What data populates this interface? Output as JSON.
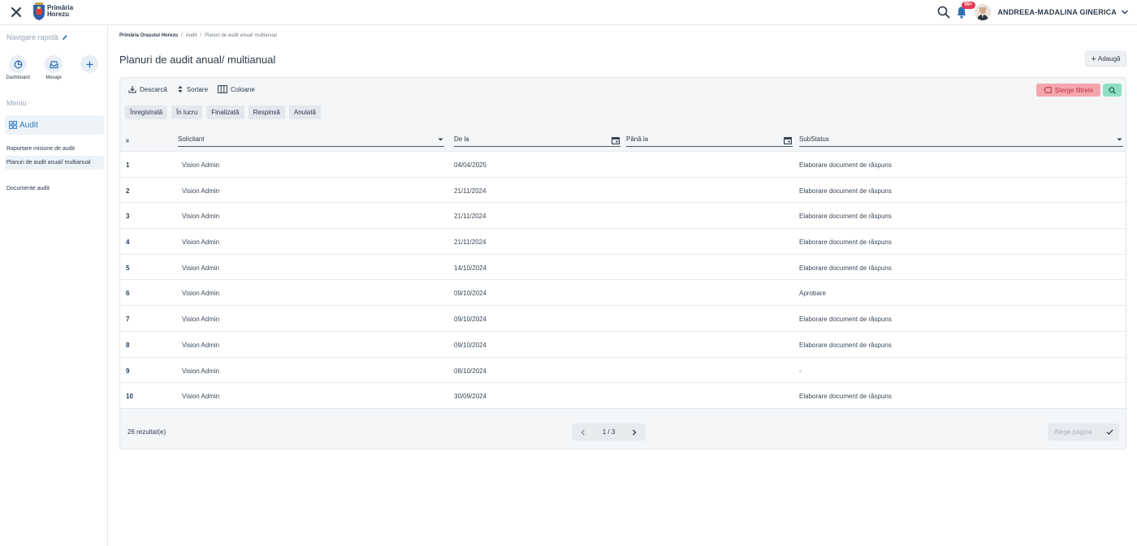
{
  "brand": {
    "line1": "Primăria",
    "line2": "Horezu"
  },
  "header": {
    "notification_badge": "99+",
    "user_name": "ANDREEA-MADALINA GINERICA"
  },
  "sidebar": {
    "quick_nav_title": "Navigare rapidă",
    "quick_buttons": [
      {
        "label": "Dashboard",
        "icon": "chart-pie-icon"
      },
      {
        "label": "Mesaje",
        "icon": "inbox-icon"
      },
      {
        "label": "",
        "icon": "plus-icon"
      }
    ],
    "menu_title": "Meniu",
    "section_label": "Audit",
    "items": [
      {
        "label": "Raportare misiune de audit"
      },
      {
        "label": "Planuri de audit anual/ multianual"
      },
      {
        "label": "Documente audit"
      }
    ]
  },
  "breadcrumb": {
    "root": "Primăria Orașului Horezu",
    "level2": "Audit",
    "current": "Planuri de audit anual/ multianual"
  },
  "page": {
    "title": "Planuri de audit anual/ multianual",
    "add_label": "Adaugă"
  },
  "toolbar": {
    "download_label": "Descarcă",
    "sort_label": "Sortare",
    "columns_label": "Coloane",
    "clear_filters_label": "Șterge filtrele"
  },
  "status_filters": [
    "Înregistrată",
    "În lucru",
    "Finalizată",
    "Respinsă",
    "Anulată"
  ],
  "table": {
    "headers": {
      "num": "#",
      "solicitant": "Solicitant",
      "from": "De la",
      "to": "Până la",
      "substatus": "SubStatus"
    },
    "rows": [
      {
        "num": "1",
        "solicitant": "Vision Admin",
        "date": "04/04/2025",
        "substatus": "Elaborare document de răspuns"
      },
      {
        "num": "2",
        "solicitant": "Vision Admin",
        "date": "21/11/2024",
        "substatus": "Elaborare document de răspuns"
      },
      {
        "num": "3",
        "solicitant": "Vision Admin",
        "date": "21/11/2024",
        "substatus": "Elaborare document de răspuns"
      },
      {
        "num": "4",
        "solicitant": "Vision Admin",
        "date": "21/11/2024",
        "substatus": "Elaborare document de răspuns"
      },
      {
        "num": "5",
        "solicitant": "Vision Admin",
        "date": "14/10/2024",
        "substatus": "Elaborare document de răspuns"
      },
      {
        "num": "6",
        "solicitant": "Vision Admin",
        "date": "09/10/2024",
        "substatus": "Aprobare"
      },
      {
        "num": "7",
        "solicitant": "Vision Admin",
        "date": "09/10/2024",
        "substatus": "Elaborare document de răspuns"
      },
      {
        "num": "8",
        "solicitant": "Vision Admin",
        "date": "09/10/2024",
        "substatus": "Elaborare document de răspuns"
      },
      {
        "num": "9",
        "solicitant": "Vision Admin",
        "date": "08/10/2024",
        "substatus": "-"
      },
      {
        "num": "10",
        "solicitant": "Vision Admin",
        "date": "30/09/2024",
        "substatus": "Elaborare document de răspuns"
      }
    ]
  },
  "footer": {
    "results": "26 rezultat(e)",
    "page_indicator": "1 / 3",
    "page_pick_placeholder": "Alege pagina"
  }
}
